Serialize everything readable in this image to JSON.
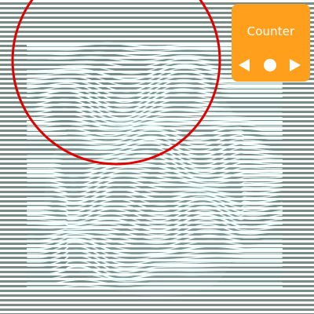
{
  "counter": {
    "title": "Counter"
  },
  "controls": {
    "previous": {
      "icon": "left-triangle-icon"
    },
    "center": {
      "icon": "dot-icon"
    },
    "next": {
      "icon": "right-triangle-icon"
    }
  },
  "colors": {
    "background": "#ffffff",
    "lines": "#7a8c86",
    "panel": "#ff9f1c",
    "panel_text": "#ffffff",
    "circle_outline": "#e00000",
    "wave_highlight": "#edfffd"
  }
}
